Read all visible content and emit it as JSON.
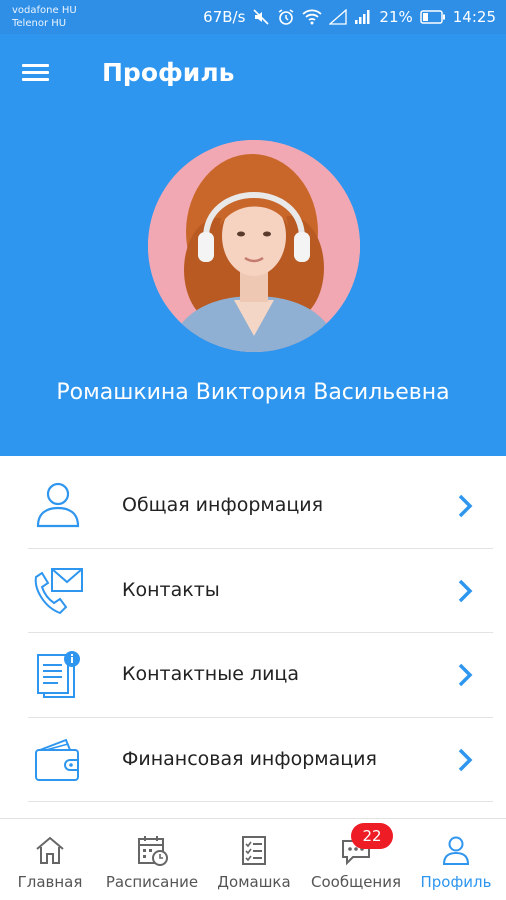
{
  "status_bar": {
    "carrier_1": "vodafone HU",
    "carrier_2": "Telenor HU",
    "speed": "67B/s",
    "battery": "21%",
    "time": "14:25"
  },
  "app_bar": {
    "title": "Профиль"
  },
  "profile": {
    "name": "Ромашкина Виктория Васильевна"
  },
  "menu": {
    "items": [
      {
        "label": "Общая информация",
        "icon": "user-icon"
      },
      {
        "label": "Контакты",
        "icon": "phone-mail-icon"
      },
      {
        "label": "Контактные лица",
        "icon": "document-info-icon"
      },
      {
        "label": "Финансовая информация",
        "icon": "wallet-icon"
      }
    ]
  },
  "bottom_nav": {
    "items": [
      {
        "label": "Главная",
        "icon": "home-icon"
      },
      {
        "label": "Расписание",
        "icon": "calendar-icon"
      },
      {
        "label": "Домашка",
        "icon": "checklist-icon"
      },
      {
        "label": "Сообщения",
        "icon": "chat-icon",
        "badge": "22"
      },
      {
        "label": "Профиль",
        "icon": "profile-icon",
        "active": true
      }
    ]
  },
  "colors": {
    "primary": "#2f96ef",
    "badge": "#ee1c25",
    "chevron": "#2f96ef"
  }
}
